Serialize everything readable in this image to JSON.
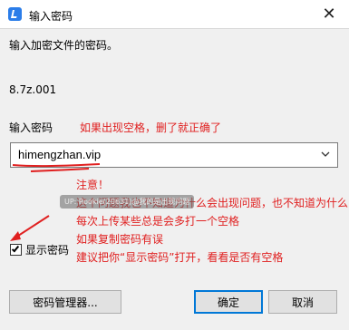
{
  "window": {
    "title": "输入密码",
    "close_glyph": "✕"
  },
  "dialog": {
    "prompt": "输入加密文件的密码。",
    "filename": "8.7z.001",
    "password_label": "输入密码",
    "password_value": "himengzhan.vip",
    "show_password_label": "显示密码",
    "show_password_checked": true
  },
  "buttons": {
    "manager": "密码管理器...",
    "ok": "确定",
    "cancel": "取消"
  },
  "annotations": {
    "note_top": "如果出现空格，删了就正确了",
    "lines": [
      "注意！",
      "这个问题我也不知道为什么会出现问题，也不知道为什么",
      "每次上传某些总是会多打一个空格",
      "如果复制密码有误",
      "建议把你“显示密码”打开，看看是否有空格"
    ],
    "color": "#e02020"
  },
  "watermark": "UP: Rookie(20631)@我的是出现问题"
}
